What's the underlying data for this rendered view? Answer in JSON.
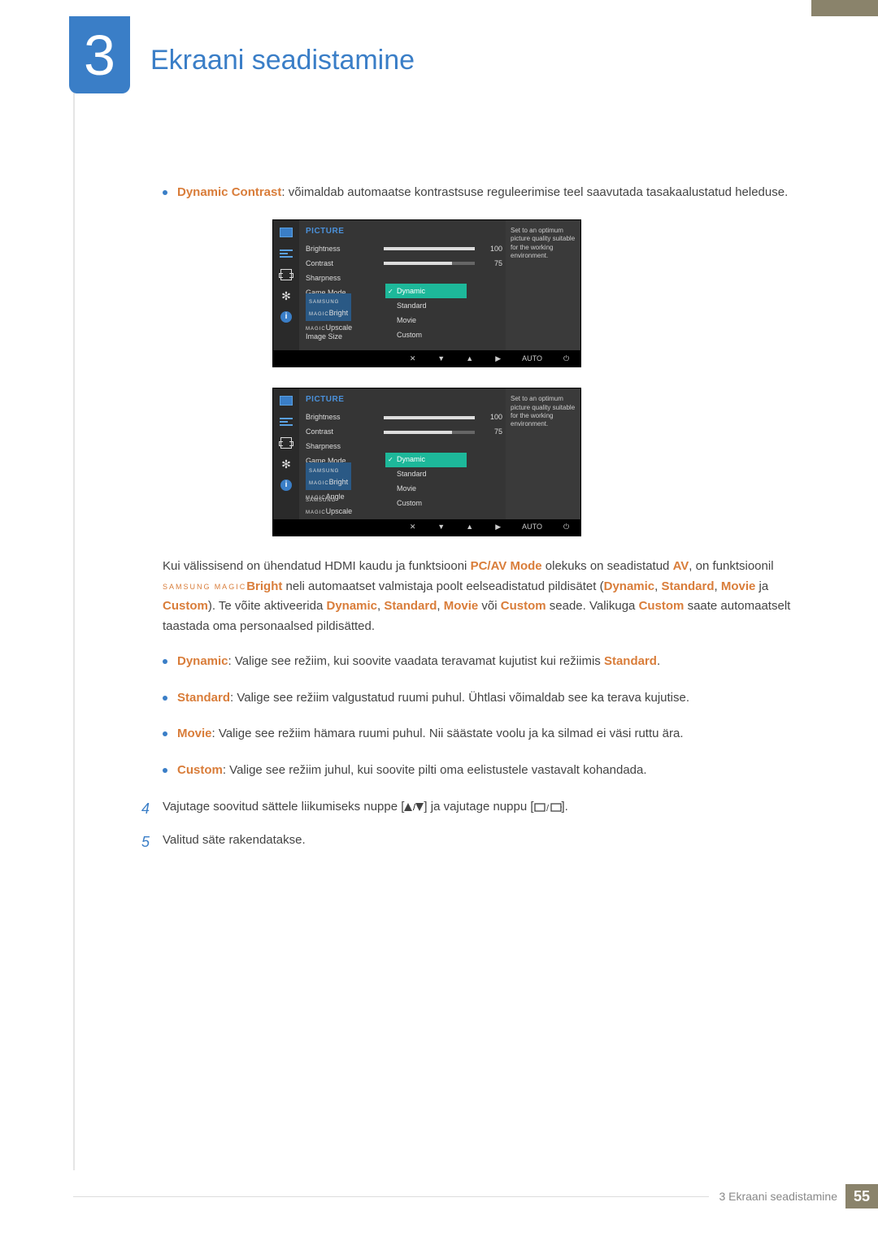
{
  "chapter": {
    "number": "3",
    "title": "Ekraani seadistamine"
  },
  "intro": {
    "term": "Dynamic Contrast",
    "text": ": võimaldab automaatse kontrastsuse reguleerimise teel saavutada tasakaalustatud heleduse."
  },
  "osd": {
    "section": "PICTURE",
    "help": "Set to an optimum picture quality suitable for the working environment.",
    "rows": {
      "brightness": {
        "label": "Brightness",
        "value": "100",
        "pct": 100
      },
      "contrast": {
        "label": "Contrast",
        "value": "75",
        "pct": 75
      },
      "sharpness": {
        "label": "Sharpness"
      },
      "gamemode": {
        "label": "Game Mode"
      },
      "magicbright": {
        "prefix": "SAMSUNG",
        "brand": "MAGIC",
        "label": "Bright"
      },
      "magicangle": {
        "prefix": "SAMSUNG",
        "brand": "MAGIC",
        "label": "Angle"
      },
      "magicupscale": {
        "prefix": "SAMSUNG",
        "brand": "MAGIC",
        "label": "Upscale"
      },
      "imagesize": {
        "label": "Image Size"
      }
    },
    "options": {
      "dynamic": "Dynamic",
      "standard": "Standard",
      "movie": "Movie",
      "custom": "Custom"
    },
    "nav": {
      "auto": "AUTO"
    }
  },
  "para": {
    "p1a": "Kui välissisend on ühendatud HDMI kaudu ja funktsiooni ",
    "p1b": "PC/AV Mode",
    "p1c": " olekuks on seadistatud ",
    "p1d": "AV",
    "p1e": ", on funktsioonil ",
    "p1f_prefix": "SAMSUNG",
    "p1f_brand": "MAGIC",
    "p1g": "Bright",
    "p1h": " neli automaatset valmistaja poolt eelseadistatud pildisätet (",
    "p1i": "Dynamic",
    "p1j": ", ",
    "p1k": "Standard",
    "p1l": ", ",
    "p1m": "Movie",
    "p1n": " ja ",
    "p1o": "Custom",
    "p1p": "). Te võite aktiveerida ",
    "p1q": "Dynamic",
    "p1r": ", ",
    "p1s": "Standard",
    "p1t": ", ",
    "p1u": "Movie",
    "p1v": " või ",
    "p1w": "Custom",
    "p1x": " seade. Valikuga ",
    "p1y": "Custom",
    "p1z": " saate automaatselt taastada oma personaalsed pildisätted."
  },
  "bullets": {
    "b1a": "Dynamic",
    "b1b": ": Valige see režiim, kui soovite vaadata teravamat kujutist kui režiimis ",
    "b1c": "Standard",
    "b1d": ".",
    "b2a": "Standard",
    "b2b": ": Valige see režiim valgustatud ruumi puhul. Ühtlasi võimaldab see ka terava kujutise.",
    "b3a": "Movie",
    "b3b": ": Valige see režiim hämara ruumi puhul. Nii säästate voolu ja ka silmad ei väsi ruttu ära.",
    "b4a": "Custom",
    "b4b": ": Valige see režiim juhul, kui soovite pilti oma eelistustele vastavalt kohandada."
  },
  "steps": {
    "s4n": "4",
    "s4a": "Vajutage soovitud sättele liikumiseks nuppe [",
    "s4b": "] ja vajutage nuppu [",
    "s4c": "].",
    "s5n": "5",
    "s5": "Valitud säte rakendatakse."
  },
  "footer": {
    "chapter": "3 Ekraani seadistamine",
    "page": "55"
  }
}
